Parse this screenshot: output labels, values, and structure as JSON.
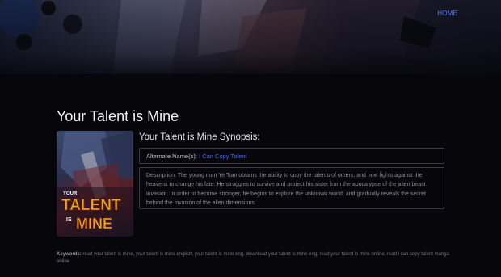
{
  "nav": {
    "home_label": "HOME"
  },
  "page": {
    "title": "Your Talent is Mine"
  },
  "cover": {
    "line1": "YOUR",
    "line2": "TALENT",
    "line3": "IS",
    "line4": "MINE"
  },
  "synopsis": {
    "heading": "Your Talent is Mine Synopsis:",
    "alt_names_label": "Alternate Name(s):",
    "alt_names_value": "I Can Copy Talent",
    "description": "Description: The young man Ye Tian obtains the ability to copy the talents of others, and now fights against the heavens to change his fate. He struggles to survive and protect his sister from the apocalypse of the alien beast invasion. In order to become stronger, he begins to explore the unknown world, and gradually reveals the secret behind the invasion of the alien dimensions."
  },
  "keywords": {
    "label": "Keywords:",
    "text": "read your talent is mine, your talent is mine english, your talent is mine eng, download your talent is mine eng, read your talent is mine online, read i can copy talent manga online"
  },
  "colors": {
    "accent": "#4d66ff",
    "background": "#06060b",
    "border": "#3c3c48"
  }
}
